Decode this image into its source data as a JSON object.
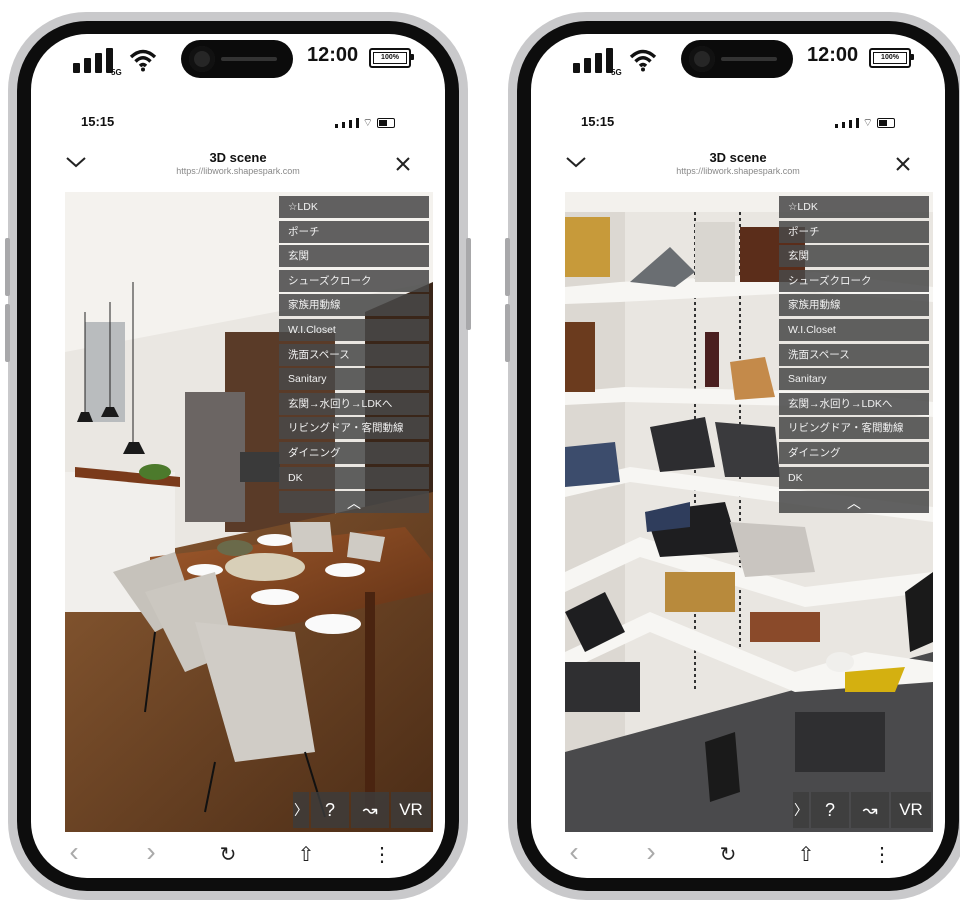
{
  "phones": [
    {
      "status": {
        "network": "5G",
        "time": "12:00",
        "battery": "100%"
      },
      "browser": {
        "inner_time": "15:15",
        "title": "3D scene",
        "url": "https://libwork.shapespark.com"
      },
      "scene": "Dining room with wooden table, chairs and kitchen",
      "menu_items": [
        "☆LDK",
        "ポーチ",
        "玄関",
        "シューズクローク",
        "家族用動線",
        "W.I.Closet",
        "洗面スペース",
        "Sanitary",
        "玄関→水回り→LDKへ",
        "リビングドア・客間動線",
        "ダイニング",
        "DK"
      ],
      "menu_collapse": "︿",
      "controls": {
        "expand": "〉",
        "help": "?",
        "path": "↝",
        "vr": "VR"
      }
    },
    {
      "status": {
        "network": "5G",
        "time": "12:00",
        "battery": "100%"
      },
      "browser": {
        "inner_time": "15:15",
        "title": "3D scene",
        "url": "https://libwork.shapespark.com"
      },
      "scene": "Shoe closet with shelves of shoes",
      "menu_items": [
        "☆LDK",
        "ポーチ",
        "玄関",
        "シューズクローク",
        "家族用動線",
        "W.I.Closet",
        "洗面スペース",
        "Sanitary",
        "玄関→水回り→LDKへ",
        "リビングドア・客間動線",
        "ダイニング",
        "DK"
      ],
      "menu_collapse": "︿",
      "controls": {
        "expand": "〉",
        "help": "?",
        "path": "↝",
        "vr": "VR"
      }
    }
  ],
  "toolbar": {
    "back": "‹",
    "forward": "›",
    "reload": "↻",
    "share": "⇧",
    "more": "⋮"
  },
  "colors": {
    "menu_bg": "#484848",
    "frame": "#c9c9cb",
    "bezel": "#0d0d0d"
  }
}
